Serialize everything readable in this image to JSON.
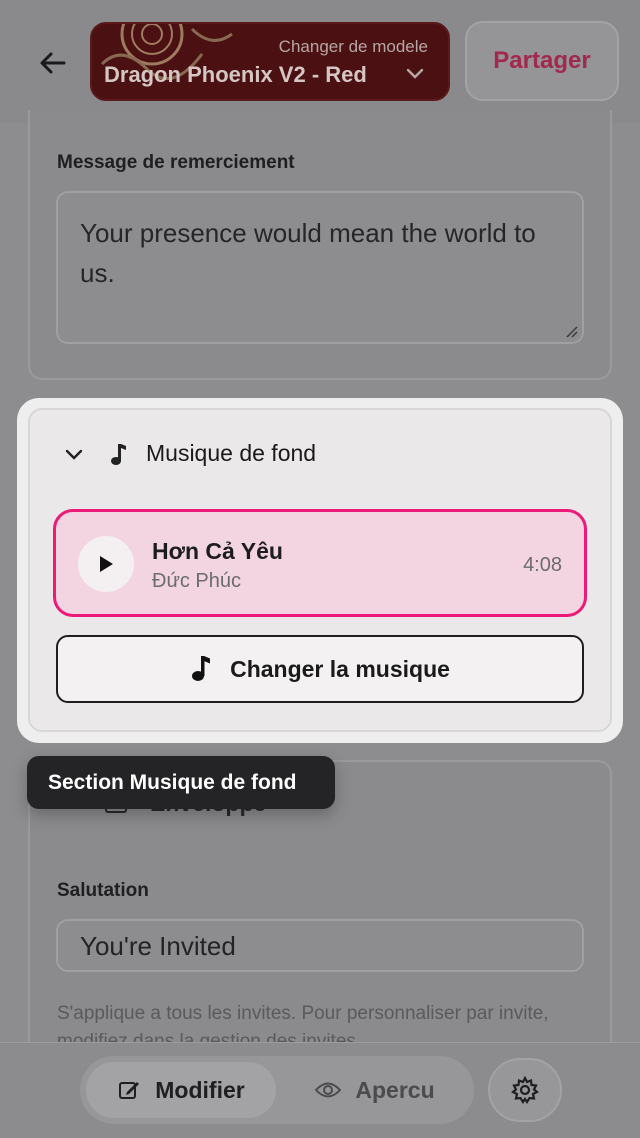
{
  "header": {
    "template": {
      "subtitle": "Changer de modele",
      "name": "Dragon Phoenix V2 - Red"
    },
    "share_label": "Partager"
  },
  "thanks_section": {
    "label": "Message de remerciement",
    "value": "Your presence would mean the world to us."
  },
  "music_section": {
    "title": "Musique de fond",
    "track": {
      "name": "Hơn Cả Yêu",
      "artist": "Đức Phúc",
      "duration": "4:08"
    },
    "change_label": "Changer la musique"
  },
  "tooltip": "Section Musique de fond",
  "envelope_section": {
    "title": "Enveloppe",
    "salutation_label": "Salutation",
    "salutation_value": "You're Invited",
    "helper": "S'applique a tous les invites. Pour personnaliser par invite, modifiez dans la gestion des invites."
  },
  "bottom_bar": {
    "edit_label": "Modifier",
    "preview_label": "Apercu"
  },
  "colors": {
    "accent": "#ec1a78",
    "track_bg": "#f3d4e1",
    "share_text": "#a2284e",
    "template_bg": "#4a1012"
  }
}
